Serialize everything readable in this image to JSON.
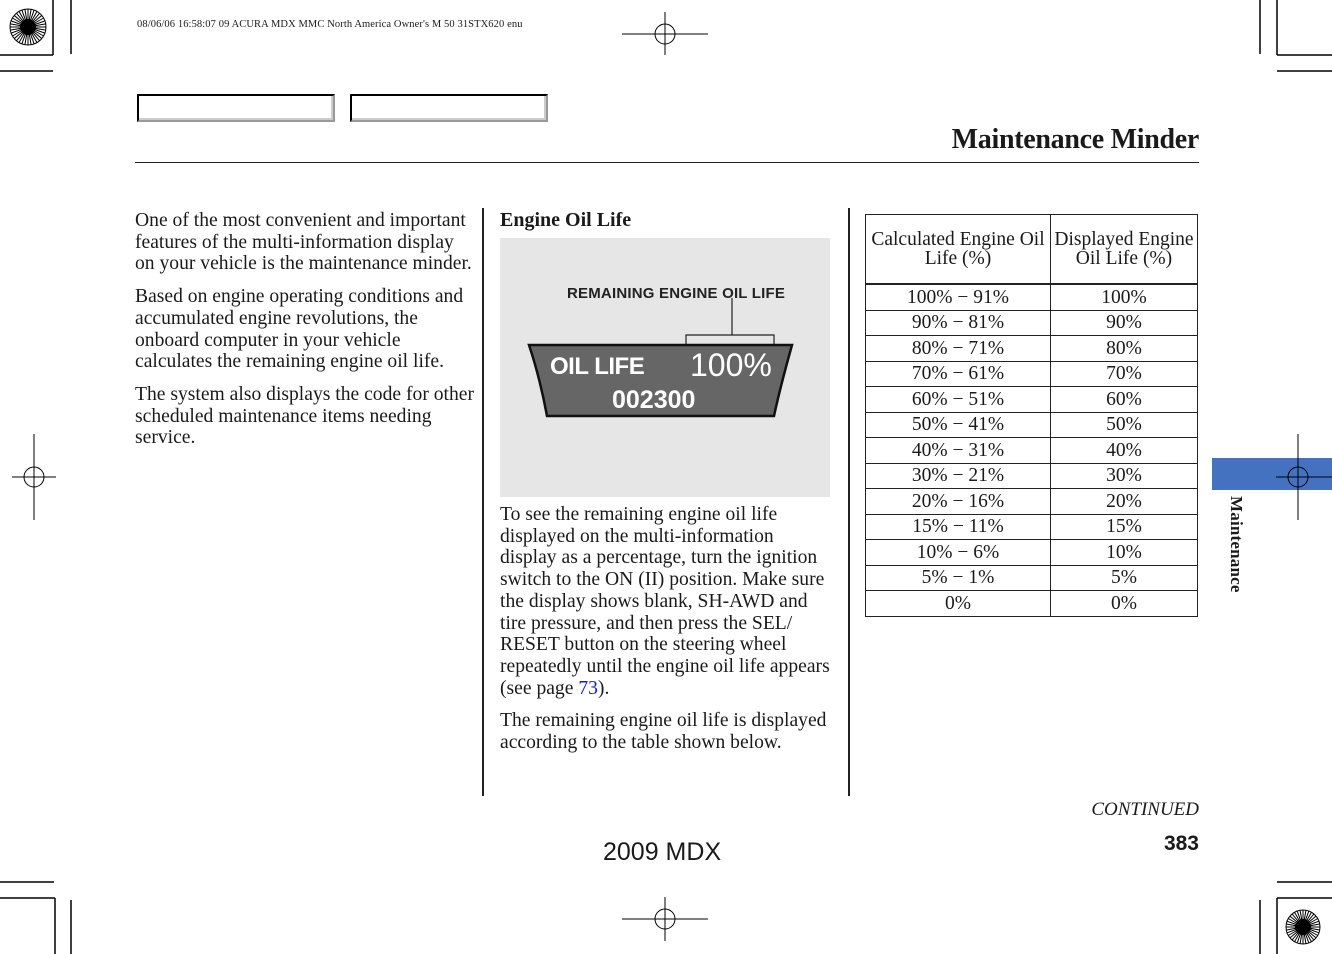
{
  "print_meta": "08/06/06 16:58:07    09 ACURA MDX MMC North America Owner's M 50 31STX620 enu",
  "page_title": "Maintenance Minder",
  "column_left": {
    "paragraphs": [
      "One of the most convenient and important features of the multi-information display on your vehicle is the maintenance minder.",
      "Based on engine operating conditions and accumulated engine revolutions, the onboard computer in your vehicle calculates the remaining engine oil life.",
      "The system also displays the code for other scheduled maintenance items needing service."
    ]
  },
  "column_middle": {
    "heading": "Engine Oil Life",
    "figure": {
      "callout_label": "REMAINING ENGINE OIL LIFE",
      "display_label": "OIL LIFE",
      "display_percent": "100%",
      "display_odometer": "002300"
    },
    "paragraph1_before_link": "To see the remaining engine oil life displayed on the multi-information display as a percentage, turn the ignition switch to the ON (II) position. Make sure the display shows blank, SH-AWD and tire pressure, and then press the SEL/ RESET button on the steering wheel repeatedly until the engine oil life appears (see page ",
    "paragraph1_link": "73",
    "paragraph1_after_link": ").",
    "paragraph2": "The remaining engine oil life is displayed according to the table shown below."
  },
  "table": {
    "headers": [
      "Calculated Engine Oil Life (%)",
      "Displayed Engine Oil Life (%)"
    ],
    "rows": [
      [
        "100% − 91%",
        "100%"
      ],
      [
        "90% − 81%",
        "90%"
      ],
      [
        "80% − 71%",
        "80%"
      ],
      [
        "70% − 61%",
        "70%"
      ],
      [
        "60% − 51%",
        "60%"
      ],
      [
        "50% − 41%",
        "50%"
      ],
      [
        "40% − 31%",
        "40%"
      ],
      [
        "30% − 21%",
        "30%"
      ],
      [
        "20% − 16%",
        "20%"
      ],
      [
        "15% − 11%",
        "15%"
      ],
      [
        "10% − 6%",
        "10%"
      ],
      [
        "5% − 1%",
        "5%"
      ],
      [
        "0%",
        "0%"
      ]
    ]
  },
  "side_tab": {
    "label": "Maintenance",
    "color": "#4472c0"
  },
  "continued_label": "CONTINUED",
  "page_number": "383",
  "footer_model": "2009  MDX",
  "colors": {
    "link": "#1a1adc",
    "display_bg": "#666666",
    "figure_bg": "#e6e6e6"
  }
}
